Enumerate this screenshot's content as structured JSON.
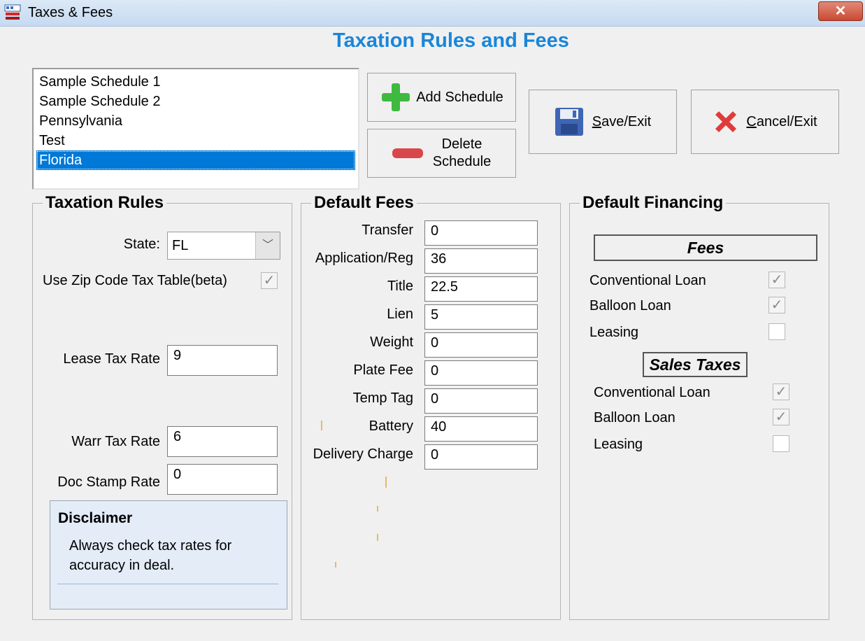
{
  "window": {
    "title": "Taxes & Fees",
    "close": "✕"
  },
  "header": {
    "title": "Taxation Rules and Fees"
  },
  "schedules": [
    "Sample Schedule 1",
    "Sample Schedule 2",
    "Pennsylvania",
    "Test",
    "Florida"
  ],
  "buttons": {
    "add": "Add Schedule",
    "delete_line1": "Delete",
    "delete_line2": "Schedule",
    "save_mnemonic": "S",
    "save_rest": "ave/Exit",
    "cancel_mnemonic": "C",
    "cancel_rest": "ancel/Exit"
  },
  "taxation": {
    "legend": "Taxation Rules",
    "state_label": "State:",
    "state_value": "FL",
    "zip_label": "Use Zip Code Tax Table(beta)",
    "lease_label": "Lease Tax Rate",
    "lease_value": "9",
    "warr_label": "Warr Tax Rate",
    "warr_value": "6",
    "doc_label": "Doc Stamp Rate",
    "doc_value": "0",
    "disclaimer_title": "Disclaimer",
    "disclaimer_text": "Always check tax rates for accuracy in deal."
  },
  "fees": {
    "legend": "Default Fees",
    "rows": [
      {
        "label": "Transfer",
        "value": "0"
      },
      {
        "label": "Application/Reg",
        "value": "36"
      },
      {
        "label": "Title",
        "value": "22.5"
      },
      {
        "label": "Lien",
        "value": "5"
      },
      {
        "label": "Weight",
        "value": "0"
      },
      {
        "label": "Plate Fee",
        "value": "0"
      },
      {
        "label": "Temp Tag",
        "value": "0"
      },
      {
        "label": "Battery",
        "value": "40"
      },
      {
        "label": "Delivery Charge",
        "value": "0"
      }
    ]
  },
  "financing": {
    "legend": "Default Financing",
    "fees_header": "Fees",
    "sales_header": "Sales Taxes",
    "fees_conventional": "Conventional Loan",
    "fees_balloon": "Balloon Loan",
    "fees_leasing": "Leasing",
    "sales_conventional": "Conventional Loan",
    "sales_balloon": "Balloon Loan",
    "sales_leasing": "Leasing"
  }
}
